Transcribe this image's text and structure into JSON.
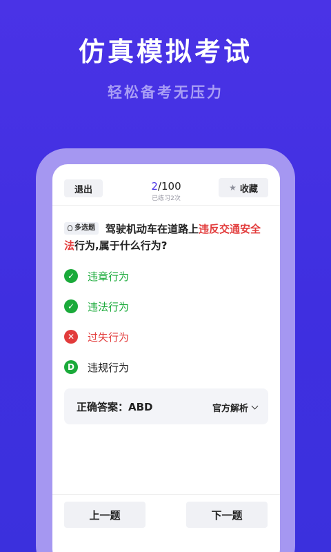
{
  "promo": {
    "title": "仿真模拟考试",
    "subtitle": "轻松备考无压力"
  },
  "topbar": {
    "exit_label": "退出",
    "progress_current": "2",
    "progress_total": "/100",
    "practice_text": "已练习2次",
    "favorite_label": "收藏"
  },
  "question": {
    "type_tag": "多选题",
    "text_before": "驾驶机动车在道路上",
    "text_highlight": "违反交通安全法",
    "text_after": "行为,属于什么行为?"
  },
  "options": [
    {
      "mark": "✓",
      "label": "违章行为",
      "status": "correct",
      "color": "#1aaa3a"
    },
    {
      "mark": "✓",
      "label": "违法行为",
      "status": "correct",
      "color": "#1aaa3a"
    },
    {
      "mark": "✕",
      "label": "过失行为",
      "status": "wrong",
      "color": "#e23b3b"
    },
    {
      "mark": "D",
      "label": "违规行为",
      "status": "missed",
      "color": "#1aaa3a"
    }
  ],
  "answer": {
    "text": "正确答案：ABD",
    "analysis_label": "官方解析"
  },
  "nav": {
    "prev_label": "上一题",
    "next_label": "下一题"
  },
  "colors": {
    "accent": "#4a33e6",
    "correct": "#1aaa3a",
    "wrong": "#e23b3b",
    "highlight": "#e23b3b"
  }
}
